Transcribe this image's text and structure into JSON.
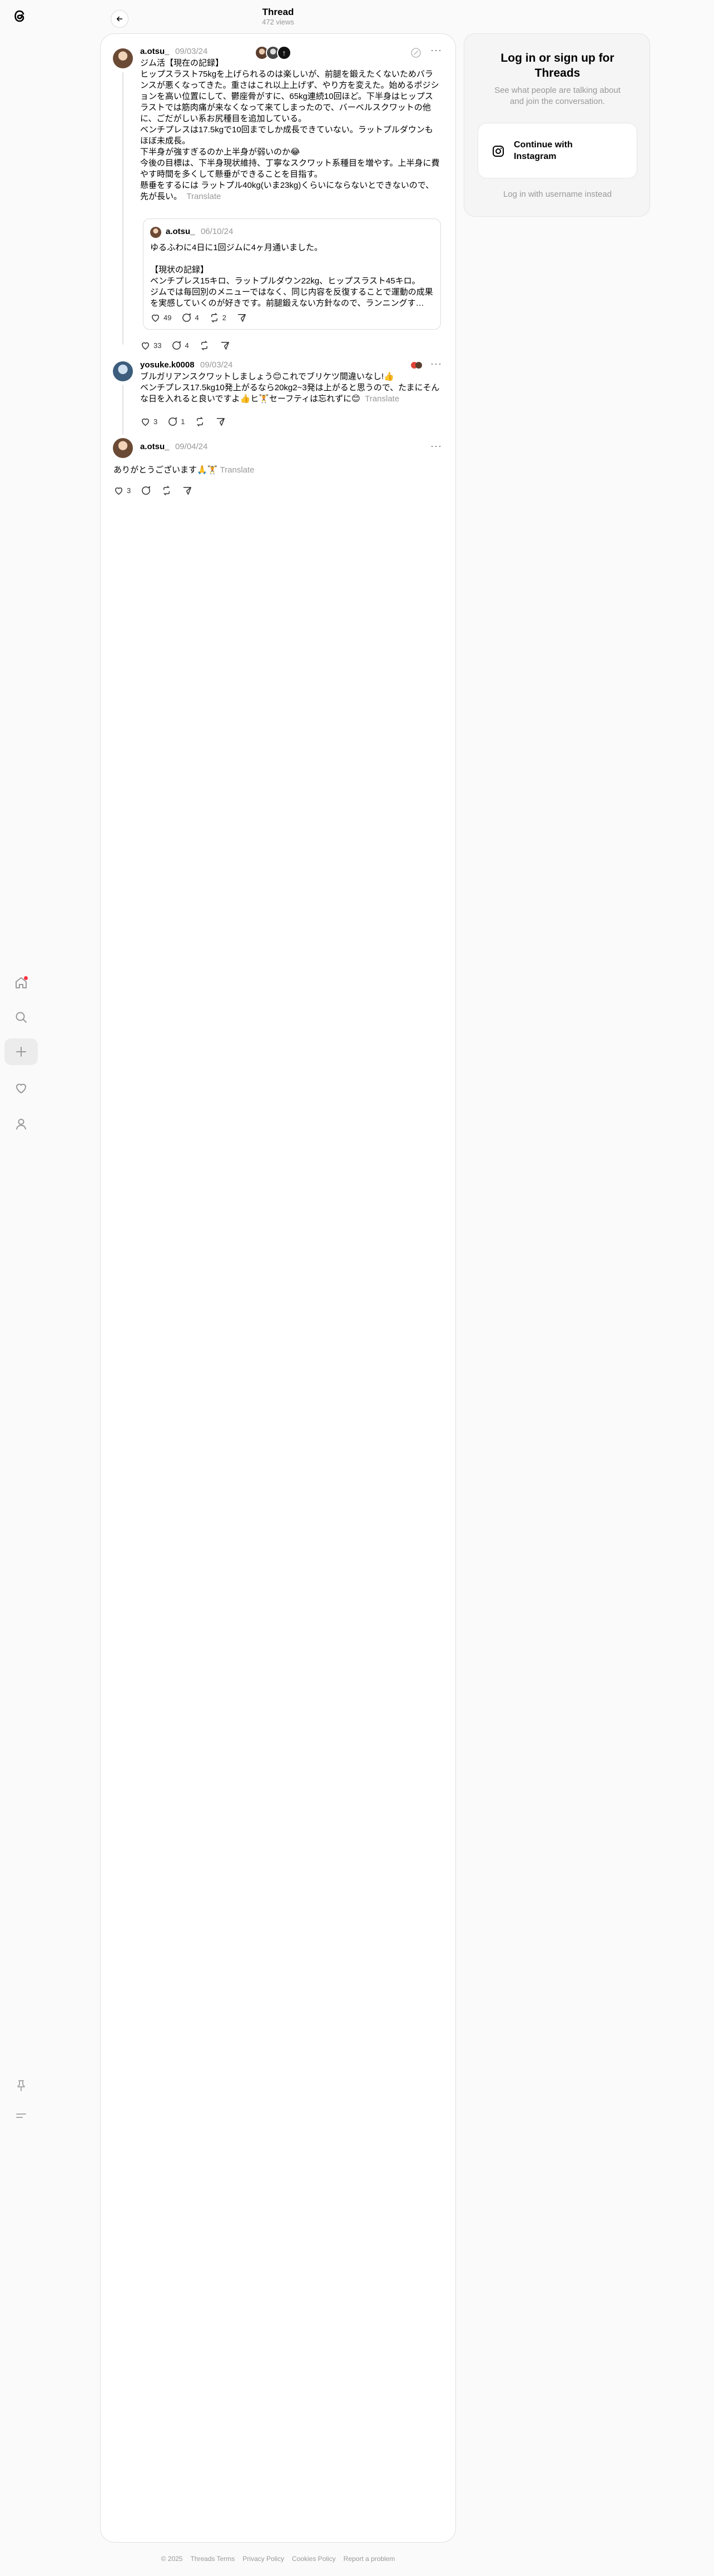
{
  "header": {
    "title": "Thread",
    "views": "472 views"
  },
  "rail": {
    "items": [
      "home-icon",
      "search-icon",
      "plus-icon",
      "heart-icon",
      "profile-icon",
      "pin-icon",
      "menu-icon"
    ]
  },
  "post": {
    "username": "a.otsu_",
    "date": "09/03/24",
    "text": "ジム活【現在の記録】\nヒップスラスト75kgを上げられるのは楽しいが、前腿を鍛えたくないためバランスが悪くなってきた。重さはこれ以上上げず、やり方を変えた。始めるポジションを高い位置にして、鬱座骨がすに、65kg連続10回ほど。下半身はヒップスラストでは筋肉痛が来なくなって来てしまったので、バーベルスクワットの他に、ごだがしい系お尻種目を追加している。\nベンチプレスは17.5kgで10回までしか成長できていない。ラットプルダウンもほぼ未成長。\n下半身が強すぎるのか上半身が弱いのか😂\n今後の目標は、下半身現状維持、丁寧なスクワット系種目を増やす。上半身に費やす時間を多くして懸垂ができることを目指す。\n懸垂をするには ラットプル40kg(いま23kg)くらいにならないとできないので、先が長い。",
    "translate": "Translate",
    "likes": "33",
    "replies": "4",
    "reposts": ""
  },
  "quote": {
    "username": "a.otsu_",
    "date": "06/10/24",
    "line1": "ゆるふわに4日に1回ジムに4ヶ月通いました。",
    "line2": "【現状の記録】",
    "line3": "ベンチプレス15キロ、ラットプルダウン22kg、ヒップスラスト45キロ。",
    "line4": "ジムでは毎回別のメニューではなく、同じ内容を反復することで運動の成果を実感していくのが好きです。前腿鍛えない方針なので、ランニングす…",
    "likes": "49",
    "replies": "4",
    "reposts": "2"
  },
  "reply1": {
    "username": "yosuke.k0008",
    "date": "09/03/24",
    "text": "ブルガリアンスクワットしましょう😊これでブリケツ間違いなし!👍\nベンチプレス17.5kg10発上がるなら20kg2~3発は上がると思うので、たまにそんな日を入れると良いですよ👍ヒ🏋セーフティは忘れずに😊",
    "translate": "Translate",
    "likes": "3",
    "replies": "1",
    "reposts": ""
  },
  "reply2": {
    "username": "a.otsu_",
    "date": "09/04/24",
    "text": "ありがとうございます🙏🏋",
    "translate": "Translate",
    "likes": "3",
    "replies": "",
    "reposts": ""
  },
  "login": {
    "title": "Log in or sign up for Threads",
    "subtitle": "See what people are talking about and join the conversation.",
    "instagram_button": "Continue with Instagram",
    "alt_login": "Log in with username instead"
  },
  "footer": {
    "links": [
      "© 2025",
      "Threads Terms",
      "Privacy Policy",
      "Cookies Policy",
      "Report a problem"
    ]
  }
}
